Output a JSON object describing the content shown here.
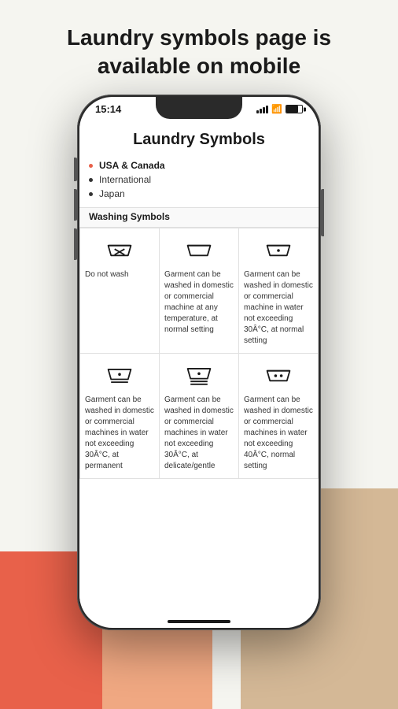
{
  "page": {
    "title_line1": "Laundry symbols page is",
    "title_line2": "available on mobile"
  },
  "status_bar": {
    "time": "15:14"
  },
  "app": {
    "title": "Laundry Symbols",
    "nav": [
      {
        "label": "USA & Canada",
        "active": true
      },
      {
        "label": "International",
        "active": false
      },
      {
        "label": "Japan",
        "active": false
      }
    ],
    "section_title": "Washing Symbols",
    "symbols": [
      [
        {
          "icon": "do-not-wash",
          "text": "Do not wash"
        },
        {
          "icon": "wash-any-temp",
          "text": "Garment can be washed in domestic or commercial machine at any temperature, at normal setting"
        },
        {
          "icon": "wash-30-normal",
          "text": "Garment can be washed in domestic or commercial machine in water not exceeding 30Â°C, at normal setting"
        }
      ],
      [
        {
          "icon": "wash-30-permanent",
          "text": "Garment can be washed in domestic or commercial machines in water not exceeding 30Â°C, at permanent"
        },
        {
          "icon": "wash-30-delicate",
          "text": "Garment can be washed in domestic or commercial machines in water not exceeding 30Â°C, at delicate/gentle"
        },
        {
          "icon": "wash-40-normal",
          "text": "Garment can be washed in domestic or commercial machines in water not exceeding 40Â°C, normal setting"
        }
      ]
    ]
  }
}
